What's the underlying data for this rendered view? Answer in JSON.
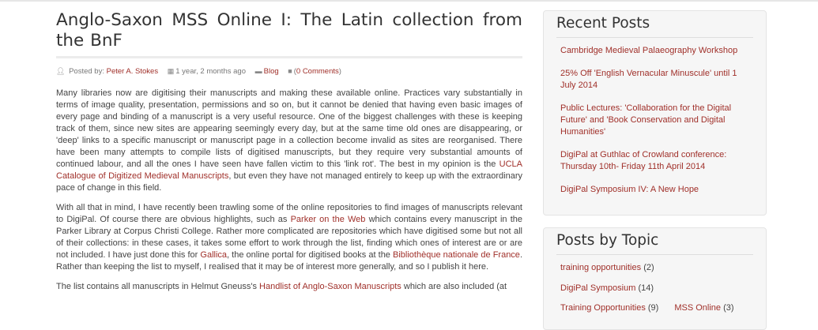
{
  "post": {
    "title": "Anglo-Saxon MSS Online I: The Latin collection from the BnF",
    "meta": {
      "posted_by_label": "Posted by:",
      "author": "Peter A. Stokes",
      "date": "1 year, 2 months ago",
      "category": "Blog",
      "comments_open": "(",
      "comments": "0 Comments",
      "comments_close": ")"
    },
    "p1": {
      "text1": "Many libraries now are digitising their manuscripts and making these available online. Practices vary substantially in terms of image quality, presentation, permissions and so on, but it cannot be denied that having even basic images of every page and binding of a manuscript is a very useful resource. One of the biggest challenges with these is keeping track of them, since new sites are appearing seemingly every day, but at the same time old ones are disappearing, or 'deep' links to a specific manuscript or manuscript page in a collection become invalid as sites are reorganised. There have been many attempts to compile lists of digitised manuscripts, but they require very substantial amounts of continued labour, and all the ones I have seen have fallen victim to this 'link rot'. The best in my opinion is the ",
      "link1": "UCLA Catalogue of Digitized Medieval Manuscripts",
      "text2": ", but even they have not managed entirely to keep up with the extraordinary pace of change in this field."
    },
    "p2": {
      "text1": "With all that in mind, I have recently been trawling some of the online repositories to find images of manuscripts relevant to DigiPal. Of course there are obvious highlights, such as ",
      "link1": "Parker on the Web",
      "text2": " which contains every manuscript in the Parker Library at Corpus Christi College. Rather more complicated are repositories which have digitised some but not all of their collections: in these cases, it takes some effort to work through the list, finding which ones of interest are or are not included. I have just done this for ",
      "link2": "Gallica",
      "text3": ", the online portal for digitised books at the ",
      "link3": "Bibliothèque nationale de France",
      "text4": ". Rather than keeping the list to myself, I realised that it may be of interest more generally, and so I publish it here."
    },
    "p3": {
      "text1": "The list contains all manuscripts in Helmut Gneuss's ",
      "link1": "Handlist of Anglo-Saxon Manuscripts",
      "text2": " which are also included (at"
    }
  },
  "sidebar": {
    "recent": {
      "title": "Recent Posts",
      "items": [
        "Cambridge Medieval Palaeography Workshop",
        "25% Off 'English Vernacular Minuscule' until 1 July 2014",
        "Public Lectures: 'Collaboration for the Digital Future' and 'Book Conservation and Digital Humanities'",
        "DigiPal at Guthlac of Crowland conference: Thursday 10th- Friday 11th April 2014",
        "DigiPal Symposium IV: A New Hope"
      ]
    },
    "topics": {
      "title": "Posts by Topic",
      "items": [
        {
          "label": "training opportunities",
          "count": "(2)"
        },
        {
          "label": "DigiPal Symposium",
          "count": "(14)"
        },
        {
          "label": "Training Opportunities",
          "count": "(9)"
        },
        {
          "label": "MSS Online",
          "count": "(3)"
        }
      ]
    }
  },
  "icons": {
    "user": "user-icon",
    "calendar": "calendar-icon",
    "folder": "folder-icon",
    "comment": "comment-icon"
  },
  "colors": {
    "link": "#a0302a",
    "sidebar_bg": "#f6f6f6"
  }
}
